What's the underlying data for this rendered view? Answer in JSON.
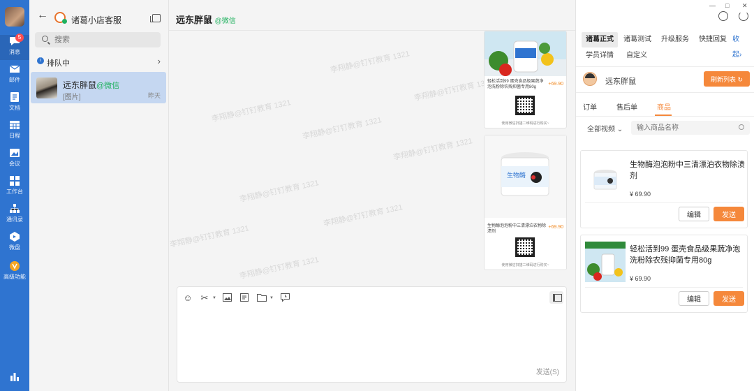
{
  "rail": {
    "badge": "5",
    "items": [
      {
        "label": "消息",
        "icon": "chat-bubble-icon"
      },
      {
        "label": "邮件",
        "icon": "mail-icon"
      },
      {
        "label": "文档",
        "icon": "document-icon"
      },
      {
        "label": "日程",
        "icon": "calendar-icon"
      },
      {
        "label": "会议",
        "icon": "meeting-icon"
      },
      {
        "label": "工作台",
        "icon": "workbench-icon"
      },
      {
        "label": "通讯录",
        "icon": "contacts-icon"
      },
      {
        "label": "微盘",
        "icon": "cloud-drive-icon"
      },
      {
        "label": "高级功能",
        "icon": "advanced-icon"
      }
    ]
  },
  "list": {
    "shop_name": "诸葛小店客服",
    "search_placeholder": "搜索",
    "queue_label": "排队中",
    "conversation": {
      "name": "远东胖鼠",
      "tag": "@微信",
      "preview": "[图片]",
      "time": "昨天"
    }
  },
  "chat": {
    "title": "远东胖鼠",
    "title_tag": "@微信",
    "watermark": "李翔静@钉钉教育 1321",
    "cards": [
      {
        "desc": "轻松活到99 蛋壳食品级果蔬净泡洗粉除农残抑菌专用80g",
        "price": "+69.90",
        "qr_tip": "使用微信扫描二维码进行购买~"
      },
      {
        "desc": "生物酶泡泡粉中三清漂泊衣物除渍剂",
        "price": "+69.90",
        "qr_tip": "使用微信扫描二维码进行购买~"
      }
    ],
    "send_label": "发送(S)"
  },
  "panel": {
    "tabs": [
      {
        "label": "诸葛正式",
        "active": true
      },
      {
        "label": "诸葛测试"
      },
      {
        "label": "升级服务"
      },
      {
        "label": "快捷回复"
      },
      {
        "label": "收起"
      },
      {
        "label": "学员详情"
      },
      {
        "label": "自定义"
      }
    ],
    "customer_name": "远东胖鼠",
    "refresh_label": "刷新列表",
    "sub_tabs": [
      "订单",
      "售后单",
      "商品"
    ],
    "filter_label": "全部视频",
    "search_placeholder": "输入商品名称",
    "products": [
      {
        "name": "生物酶泡泡粉中三清漂泊衣物除渍剂",
        "price": "¥ 69.90",
        "edit": "编辑",
        "send": "发送"
      },
      {
        "name": "轻松活到99 蛋壳食品级果蔬净泡洗粉除农残抑菌专用80g",
        "price": "¥ 69.90",
        "edit": "编辑",
        "send": "发送"
      }
    ]
  }
}
